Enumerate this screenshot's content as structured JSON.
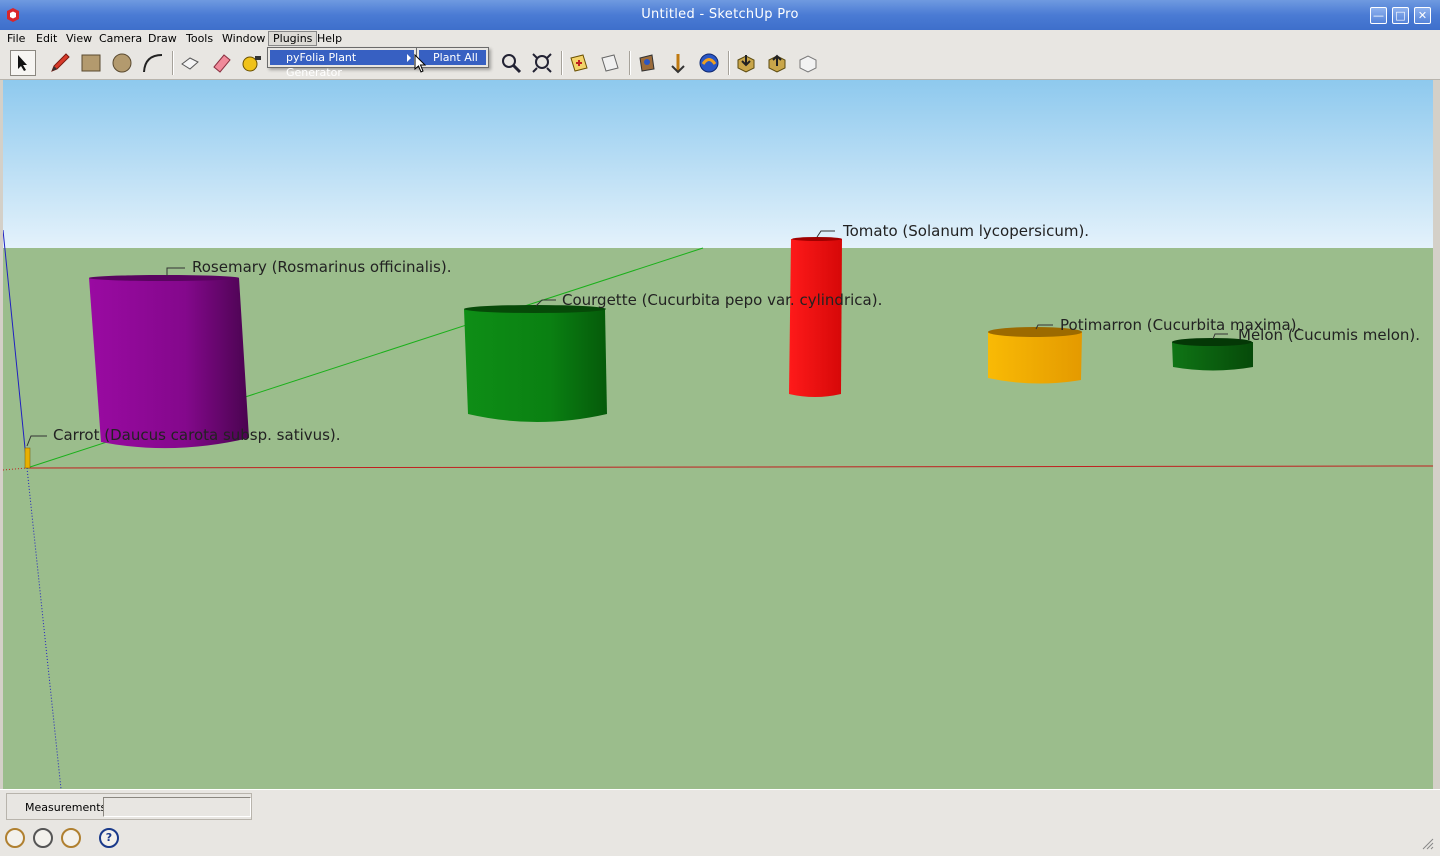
{
  "window": {
    "title": "Untitled - SketchUp Pro"
  },
  "menubar": {
    "items": [
      {
        "label": "File"
      },
      {
        "label": "Edit"
      },
      {
        "label": "View"
      },
      {
        "label": "Camera"
      },
      {
        "label": "Draw"
      },
      {
        "label": "Tools"
      },
      {
        "label": "Window"
      },
      {
        "label": "Plugins"
      },
      {
        "label": "Help"
      }
    ]
  },
  "plugins_menu": {
    "item": "pyFolia Plant Generator",
    "submenu_item": "Plant All"
  },
  "toolbar": {
    "tools": [
      "select-tool",
      "pencil-tool",
      "rectangle-tool",
      "circle-tool",
      "arc-tool",
      "make-component-tool",
      "eraser-tool",
      "tape-measure-tool",
      "zoom-tool",
      "zoom-extents-tool",
      "previous-view-tool",
      "next-view-tool",
      "position-camera-tool",
      "walk-tool",
      "look-around-tool",
      "get-models-tool",
      "share-model-tool",
      "share-component-tool"
    ]
  },
  "viewport": {
    "sky_color": "#b6dcf3",
    "ground_color": "#9bbd8c",
    "plants": [
      {
        "label": "Rosemary (Rosmarinus officinalis).",
        "color": "#8f0a96"
      },
      {
        "label": "Courgette (Cucurbita pepo var. cylindrica).",
        "color": "#0c8a14"
      },
      {
        "label": "Tomato (Solanum lycopersicum).",
        "color": "#f01010"
      },
      {
        "label": "Potimarron (Cucurbita maxima).",
        "color": "#f5b400"
      },
      {
        "label": "Melon (Cucumis melon).",
        "color": "#0d6f12"
      },
      {
        "label": "Carrot (Daucus carota subsp. sativus).",
        "color": "#e8b000"
      }
    ]
  },
  "status": {
    "measurements_label": "Measurements",
    "measurements_value": ""
  }
}
